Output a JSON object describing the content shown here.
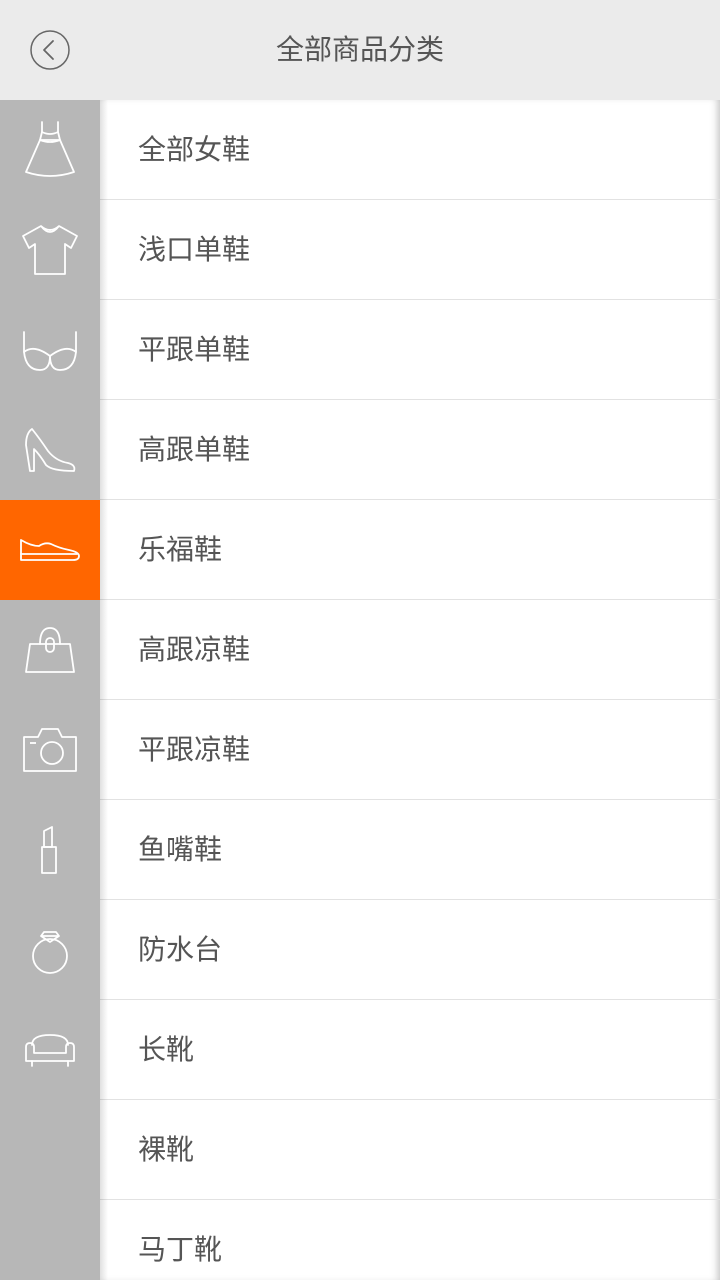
{
  "header": {
    "title": "全部商品分类",
    "back_icon": "chevron-left-circle-icon"
  },
  "colors": {
    "header_bg": "#ebebeb",
    "sidebar_bg": "#b7b7b7",
    "accent": "#ff6600",
    "text": "#555555",
    "divider": "#e2e2e2"
  },
  "sidebar": {
    "active_index": 4,
    "items": [
      {
        "icon": "dress-icon"
      },
      {
        "icon": "tshirt-icon"
      },
      {
        "icon": "bra-icon"
      },
      {
        "icon": "high-heel-icon"
      },
      {
        "icon": "flat-shoe-icon"
      },
      {
        "icon": "handbag-icon"
      },
      {
        "icon": "camera-icon"
      },
      {
        "icon": "lipstick-icon"
      },
      {
        "icon": "ring-icon"
      },
      {
        "icon": "sofa-icon"
      }
    ]
  },
  "categories": [
    {
      "label": "全部女鞋"
    },
    {
      "label": "浅口单鞋"
    },
    {
      "label": "平跟单鞋"
    },
    {
      "label": "高跟单鞋"
    },
    {
      "label": "乐福鞋"
    },
    {
      "label": "高跟凉鞋"
    },
    {
      "label": "平跟凉鞋"
    },
    {
      "label": "鱼嘴鞋"
    },
    {
      "label": "防水台"
    },
    {
      "label": "长靴"
    },
    {
      "label": "裸靴"
    },
    {
      "label": "马丁靴"
    }
  ]
}
